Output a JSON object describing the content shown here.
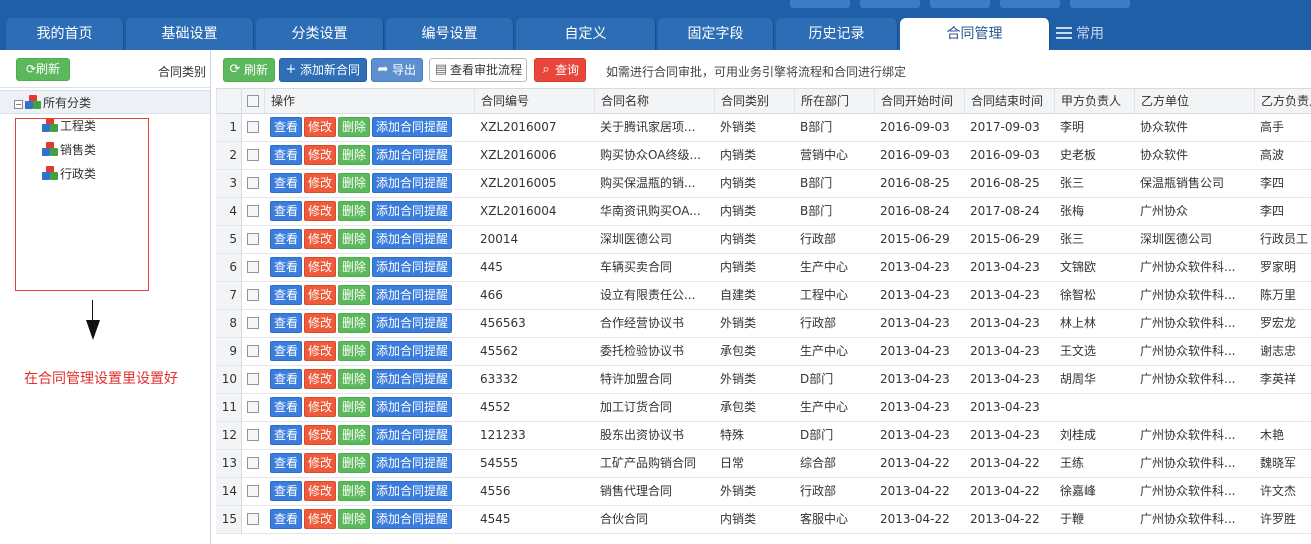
{
  "tabs": [
    {
      "label": "我的首页",
      "active": false
    },
    {
      "label": "基础设置",
      "active": false
    },
    {
      "label": "分类设置",
      "active": false
    },
    {
      "label": "编号设置",
      "active": false
    },
    {
      "label": "自定义",
      "active": false
    },
    {
      "label": "固定字段",
      "active": false
    },
    {
      "label": "历史记录",
      "active": false
    },
    {
      "label": "合同管理",
      "active": true
    }
  ],
  "common_tab": "常用",
  "left": {
    "refresh_label": "刷新",
    "title": "合同类别",
    "tree_root": "所有分类",
    "tree_items": [
      "工程类",
      "销售类",
      "行政类"
    ],
    "annotation": "在合同管理设置里设置好"
  },
  "toolbar": {
    "refresh": "刷新",
    "add": "添加新合同",
    "export": "导出",
    "view_flow": "查看审批流程",
    "query": "查询",
    "hint": "如需进行合同审批，可用业务引擎将流程和合同进行绑定"
  },
  "columns": [
    "操作",
    "合同编号",
    "合同名称",
    "合同类别",
    "所在部门",
    "合同开始时间",
    "合同结束时间",
    "甲方负责人",
    "乙方单位",
    "乙方负责人"
  ],
  "actions": {
    "view": "查看",
    "edit": "修改",
    "delete": "删除",
    "remind": "添加合同提醒"
  },
  "rows": [
    {
      "n": "1",
      "code": "XZL2016007",
      "name": "关于腾讯家居项...",
      "type": "外销类",
      "dept": "B部门",
      "start": "2016-09-03",
      "end": "2017-09-03",
      "a_lead": "李明",
      "b_unit": "协众软件",
      "b_lead": "高手"
    },
    {
      "n": "2",
      "code": "XZL2016006",
      "name": "购买协众OA终级...",
      "type": "内销类",
      "dept": "营销中心",
      "start": "2016-09-03",
      "end": "2016-09-03",
      "a_lead": "史老板",
      "b_unit": "协众软件",
      "b_lead": "高波"
    },
    {
      "n": "3",
      "code": "XZL2016005",
      "name": "购买保温瓶的销...",
      "type": "内销类",
      "dept": "B部门",
      "start": "2016-08-25",
      "end": "2016-08-25",
      "a_lead": "张三",
      "b_unit": "保温瓶销售公司",
      "b_lead": "李四"
    },
    {
      "n": "4",
      "code": "XZL2016004",
      "name": "华南资讯购买OA...",
      "type": "内销类",
      "dept": "B部门",
      "start": "2016-08-24",
      "end": "2017-08-24",
      "a_lead": "张梅",
      "b_unit": "广州协众",
      "b_lead": "李四"
    },
    {
      "n": "5",
      "code": "20014",
      "name": "深圳医德公司",
      "type": "内销类",
      "dept": "行政部",
      "start": "2015-06-29",
      "end": "2015-06-29",
      "a_lead": "张三",
      "b_unit": "深圳医德公司",
      "b_lead": "行政员工"
    },
    {
      "n": "6",
      "code": "445",
      "name": "车辆买卖合同",
      "type": "内销类",
      "dept": "生产中心",
      "start": "2013-04-23",
      "end": "2013-04-23",
      "a_lead": "文锦欧",
      "b_unit": "广州协众软件科...",
      "b_lead": "罗家明"
    },
    {
      "n": "7",
      "code": "466",
      "name": "设立有限责任公...",
      "type": "自建类",
      "dept": "工程中心",
      "start": "2013-04-23",
      "end": "2013-04-23",
      "a_lead": "徐智松",
      "b_unit": "广州协众软件科...",
      "b_lead": "陈万里"
    },
    {
      "n": "8",
      "code": "456563",
      "name": "合作经营协议书",
      "type": "外销类",
      "dept": "行政部",
      "start": "2013-04-23",
      "end": "2013-04-23",
      "a_lead": "林上林",
      "b_unit": "广州协众软件科...",
      "b_lead": "罗宏龙"
    },
    {
      "n": "9",
      "code": "45562",
      "name": "委托检验协议书",
      "type": "承包类",
      "dept": "生产中心",
      "start": "2013-04-23",
      "end": "2013-04-23",
      "a_lead": "王文选",
      "b_unit": "广州协众软件科...",
      "b_lead": "谢志忠"
    },
    {
      "n": "10",
      "code": "63332",
      "name": "特许加盟合同",
      "type": "外销类",
      "dept": "D部门",
      "start": "2013-04-23",
      "end": "2013-04-23",
      "a_lead": "胡周华",
      "b_unit": "广州协众软件科...",
      "b_lead": "李英祥"
    },
    {
      "n": "11",
      "code": "4552",
      "name": "加工订货合同",
      "type": "承包类",
      "dept": "生产中心",
      "start": "2013-04-23",
      "end": "2013-04-23",
      "a_lead": "",
      "b_unit": "",
      "b_lead": ""
    },
    {
      "n": "12",
      "code": "121233",
      "name": "股东出资协议书",
      "type": "特殊",
      "dept": "D部门",
      "start": "2013-04-23",
      "end": "2013-04-23",
      "a_lead": "刘桂成",
      "b_unit": "广州协众软件科...",
      "b_lead": "木艳"
    },
    {
      "n": "13",
      "code": "54555",
      "name": "工矿产品购销合同",
      "type": "日常",
      "dept": "综合部",
      "start": "2013-04-22",
      "end": "2013-04-22",
      "a_lead": "王练",
      "b_unit": "广州协众软件科...",
      "b_lead": "魏晓军"
    },
    {
      "n": "14",
      "code": "4556",
      "name": "销售代理合同",
      "type": "外销类",
      "dept": "行政部",
      "start": "2013-04-22",
      "end": "2013-04-22",
      "a_lead": "徐嘉峰",
      "b_unit": "广州协众软件科...",
      "b_lead": "许文杰"
    },
    {
      "n": "15",
      "code": "4545",
      "name": "合伙合同",
      "type": "内销类",
      "dept": "客服中心",
      "start": "2013-04-22",
      "end": "2013-04-22",
      "a_lead": "于鞭",
      "b_unit": "广州协众软件科...",
      "b_lead": "许罗胜"
    }
  ]
}
